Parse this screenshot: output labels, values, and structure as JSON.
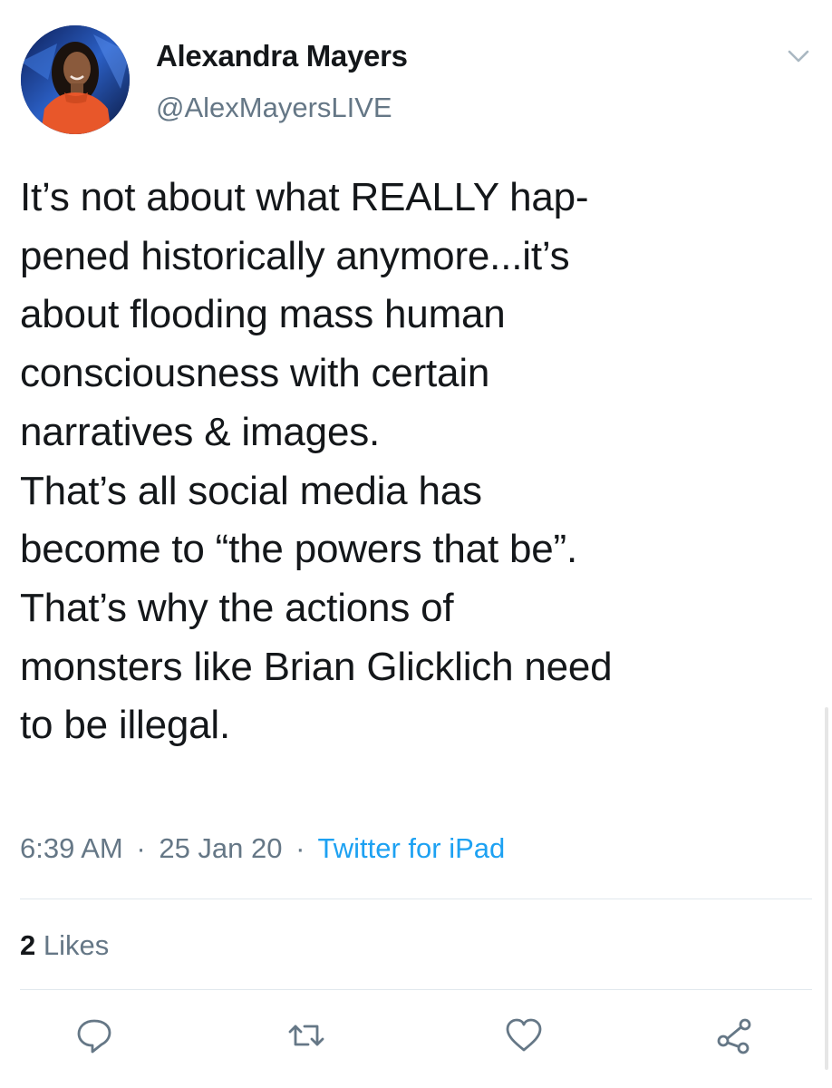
{
  "author": {
    "display_name": "Alexandra Mayers",
    "handle": "@AlexMayersLIVE",
    "avatar_icon": "user-avatar-photo"
  },
  "tweet": {
    "lines": [
      "It’s not about what REALLY hap-",
      "pened historically anymore...it’s",
      "about flooding mass human",
      "consciousness with certain",
      "narratives & images.",
      "That’s all social media has",
      "become to “the powers that be”.",
      "That’s why the actions of",
      "monsters like Brian Glicklich need",
      "to be illegal."
    ],
    "time": "6:39 AM",
    "date": "25 Jan 20",
    "separator": "·",
    "source": "Twitter for iPad"
  },
  "stats": {
    "likes_count": "2",
    "likes_label": "Likes"
  },
  "actions": {
    "reply_icon": "reply-icon",
    "retweet_icon": "retweet-icon",
    "like_icon": "heart-icon",
    "share_icon": "share-icon"
  },
  "colors": {
    "text": "#14171a",
    "secondary": "#657786",
    "link": "#1da1f2",
    "divider": "#e1e8ed"
  }
}
